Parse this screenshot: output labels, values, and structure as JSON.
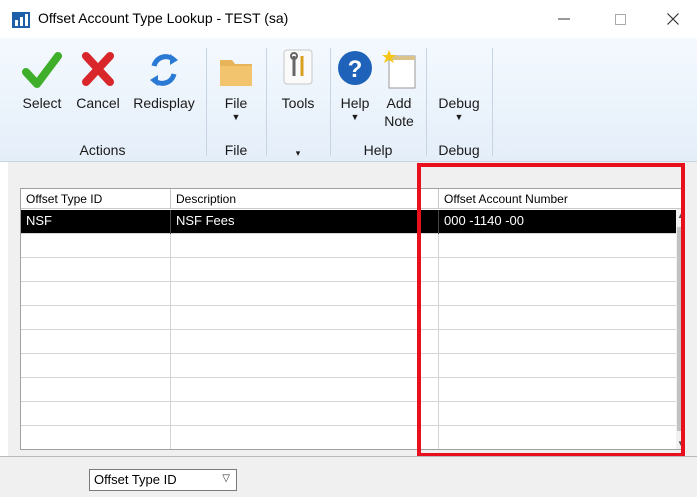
{
  "window": {
    "title": "Offset Account Type Lookup  -  TEST (sa)",
    "controls": {
      "minimize": "—",
      "maximize": "☐",
      "close": "✕"
    }
  },
  "ribbon": {
    "groups": [
      {
        "label": "Actions",
        "buttons": [
          {
            "label": "Select",
            "icon": "checkmark-icon"
          },
          {
            "label": "Cancel",
            "icon": "x-icon"
          },
          {
            "label": "Redisplay",
            "icon": "refresh-icon"
          }
        ]
      },
      {
        "label": "File",
        "buttons": [
          {
            "label": "File",
            "icon": "folder-icon",
            "dropdown": true
          }
        ]
      },
      {
        "label": "",
        "buttons": [
          {
            "label": "Tools",
            "icon": "tools-icon"
          }
        ]
      },
      {
        "label": "Help",
        "buttons": [
          {
            "label": "Help",
            "icon": "help-icon",
            "dropdown": true
          },
          {
            "label": "Add Note",
            "label_line1": "Add",
            "label_line2": "Note",
            "icon": "note-icon"
          }
        ]
      },
      {
        "label": "Debug",
        "buttons": [
          {
            "label": "Debug",
            "icon": "debug-icon",
            "dropdown": true
          }
        ]
      }
    ],
    "colors": {
      "check": "#3fae2a",
      "cancel": "#d8262b",
      "redisplay": "#2a79d4",
      "help": "#1e63b9"
    }
  },
  "table": {
    "columns": [
      "Offset Type ID",
      "Description",
      "Offset Account Number"
    ],
    "rows": [
      {
        "id": "NSF",
        "description": "NSF Fees",
        "account": "000 -1140 -00",
        "selected": true
      }
    ],
    "empty_rows": 9
  },
  "highlight": {
    "color": "#e8101c"
  },
  "footer": {
    "sort_by": "Offset Type ID"
  }
}
